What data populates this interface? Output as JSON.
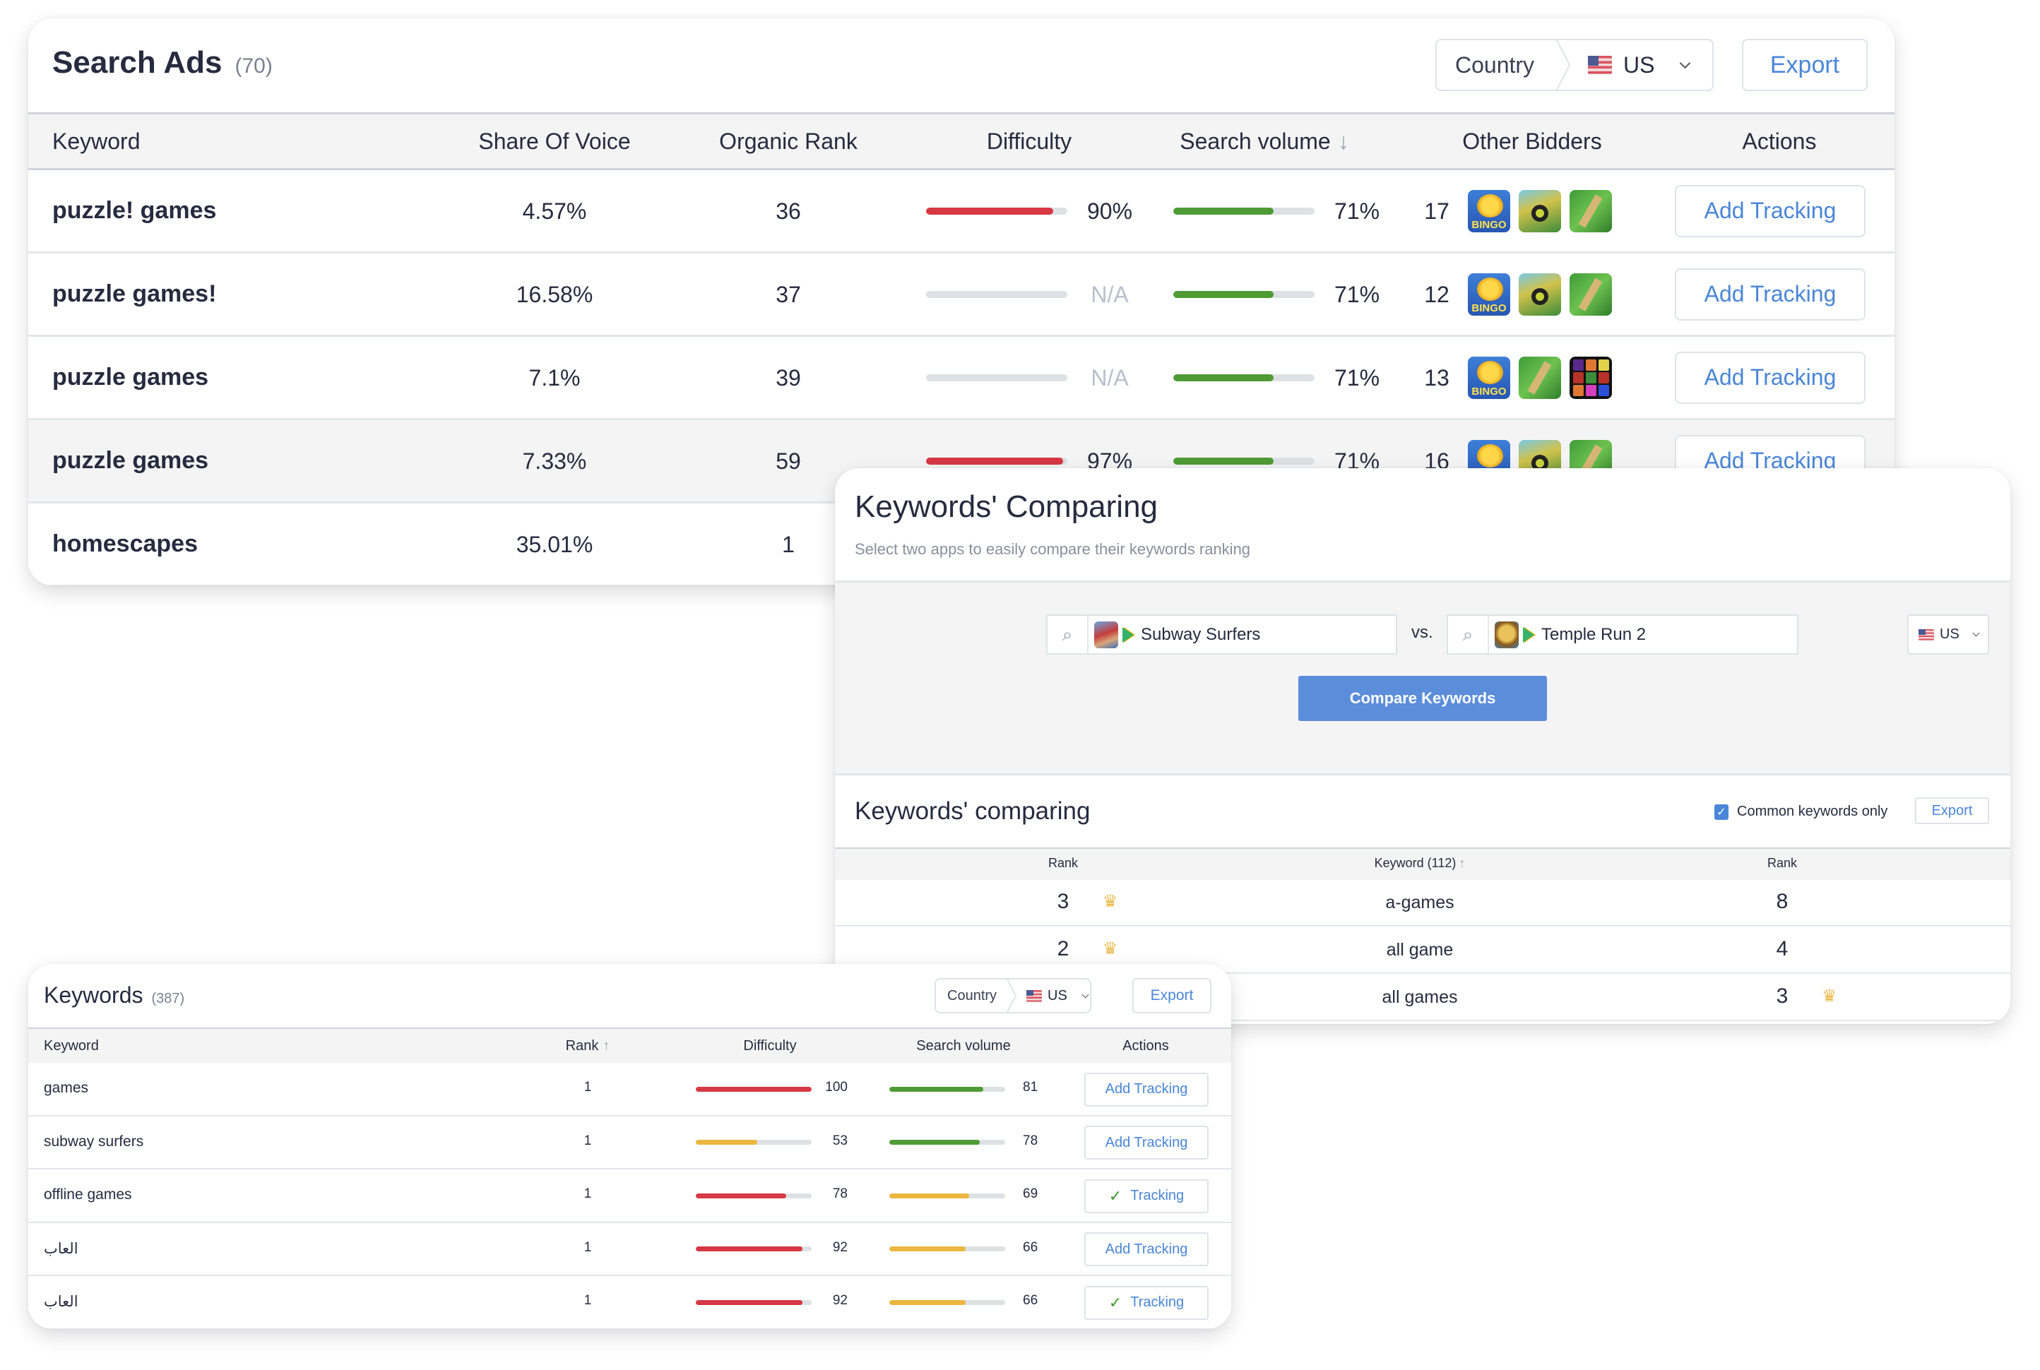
{
  "colors": {
    "accent_blue": "#4a86d8",
    "red": "#d63844",
    "green": "#4f9b35",
    "yellow": "#ebb740",
    "track": "#dde1e4",
    "na_text": "#b8bfcc",
    "compare_button": "#5b8ddb",
    "crown": "#e9b949",
    "check_green": "#3b9a2c"
  },
  "search_ads": {
    "title": "Search Ads",
    "count": "(70)",
    "country_label": "Country",
    "country_value": "US",
    "export_label": "Export",
    "columns": [
      "Keyword",
      "Share Of Voice",
      "Organic Rank",
      "Difficulty",
      "Search volume",
      "Other Bidders",
      "Actions"
    ],
    "sort_icon": "arrow-down-icon",
    "rows": [
      {
        "keyword": "puzzle! games",
        "share_of_voice": "4.57%",
        "organic_rank": "36",
        "difficulty": 90,
        "difficulty_label": "90%",
        "search_volume": 71,
        "search_volume_label": "71%",
        "bidders": "17",
        "bidder_icons": [
          "bingo-app-icon",
          "turtle-app-icon",
          "maze-app-icon"
        ],
        "action": "Add Tracking"
      },
      {
        "keyword": "puzzle games!",
        "share_of_voice": "16.58%",
        "organic_rank": "37",
        "difficulty": null,
        "difficulty_label": "N/A",
        "search_volume": 71,
        "search_volume_label": "71%",
        "bidders": "12",
        "bidder_icons": [
          "bingo-app-icon",
          "turtle-app-icon",
          "maze-app-icon"
        ],
        "action": "Add Tracking"
      },
      {
        "keyword": "puzzle games",
        "share_of_voice": "7.1%",
        "organic_rank": "39",
        "difficulty": null,
        "difficulty_label": "N/A",
        "search_volume": 71,
        "search_volume_label": "71%",
        "bidders": "13",
        "bidder_icons": [
          "bingo-app-icon",
          "maze-app-icon",
          "color-grid-app-icon"
        ],
        "action": "Add Tracking"
      },
      {
        "keyword": "puzzle games",
        "share_of_voice": "7.33%",
        "organic_rank": "59",
        "difficulty": 97,
        "difficulty_label": "97%",
        "search_volume": 71,
        "search_volume_label": "71%",
        "bidders": "16",
        "bidder_icons": [
          "bingo-app-icon",
          "turtle-app-icon",
          "maze-app-icon"
        ],
        "action": "Add Tracking"
      },
      {
        "keyword": "homescapes",
        "share_of_voice": "35.01%",
        "organic_rank": "1"
      }
    ]
  },
  "compare": {
    "title": "Keywords' Comparing",
    "subtitle": "Select two apps to easily compare their keywords ranking",
    "app1": "Subway Surfers",
    "vs": "vs.",
    "app2": "Temple Run 2",
    "country_value": "US",
    "compare_button": "Compare Keywords",
    "results_title": "Keywords' comparing",
    "common_only_label": "Common keywords only",
    "common_only_checked": true,
    "export_label": "Export",
    "columns": [
      "Rank",
      "Keyword (112)",
      "Rank"
    ],
    "rows": [
      {
        "rank1": "3",
        "winner": "left",
        "keyword": "a-games",
        "rank2": "8"
      },
      {
        "rank1": "2",
        "winner": "left",
        "keyword": "all game",
        "rank2": "4"
      },
      {
        "rank1": "",
        "winner": "right",
        "keyword": "all games",
        "rank2": "3"
      }
    ]
  },
  "keywords": {
    "title": "Keywords",
    "count": "(387)",
    "country_label": "Country",
    "country_value": "US",
    "export_label": "Export",
    "columns": [
      "Keyword",
      "Rank",
      "Difficulty",
      "Search volume",
      "Actions"
    ],
    "rows": [
      {
        "keyword": "games",
        "rank": "1",
        "difficulty": 100,
        "search_volume": 81,
        "action": "Add Tracking",
        "tracking": false
      },
      {
        "keyword": "subway surfers",
        "rank": "1",
        "difficulty": 53,
        "search_volume": 78,
        "action": "Add Tracking",
        "tracking": false
      },
      {
        "keyword": "offline games",
        "rank": "1",
        "difficulty": 78,
        "search_volume": 69,
        "action": "Tracking",
        "tracking": true
      },
      {
        "keyword": "العاب",
        "rank": "1",
        "difficulty": 92,
        "search_volume": 66,
        "action": "Add Tracking",
        "tracking": false
      },
      {
        "keyword": "العاب",
        "rank": "1",
        "difficulty": 92,
        "search_volume": 66,
        "action": "Tracking",
        "tracking": true
      }
    ]
  }
}
